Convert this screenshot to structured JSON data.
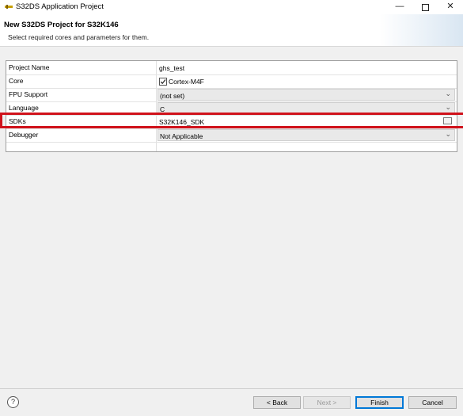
{
  "window": {
    "title": "S32DS Application Project",
    "minimize_glyph": "—",
    "close_glyph": "✕"
  },
  "header": {
    "title": "New S32DS Project for S32K146",
    "subtitle": "Select required cores and parameters for them."
  },
  "table": {
    "rows": [
      {
        "label": "Project Name",
        "value": "ghs_test",
        "type": "text"
      },
      {
        "label": "Core",
        "value": "Cortex-M4F",
        "type": "checkbox",
        "checked": true
      },
      {
        "label": "FPU Support",
        "value": "(not set)",
        "type": "combo"
      },
      {
        "label": "Language",
        "value": "C",
        "type": "combo"
      },
      {
        "label": "SDKs",
        "value": "S32K146_SDK",
        "type": "browse"
      },
      {
        "label": "Debugger",
        "value": "Not Applicable",
        "type": "combo"
      }
    ]
  },
  "buttons": {
    "help": "?",
    "back": "< Back",
    "next": "Next >",
    "finish": "Finish",
    "cancel": "Cancel"
  },
  "icons": {
    "app": "s32ds-app-icon",
    "checkbox": "checkmark-icon",
    "combo_chevron": "chevron-down-icon",
    "browse": "browse-icon",
    "help": "help-icon"
  },
  "colors": {
    "highlight": "#d0121b",
    "finish_border": "#0078d7"
  }
}
